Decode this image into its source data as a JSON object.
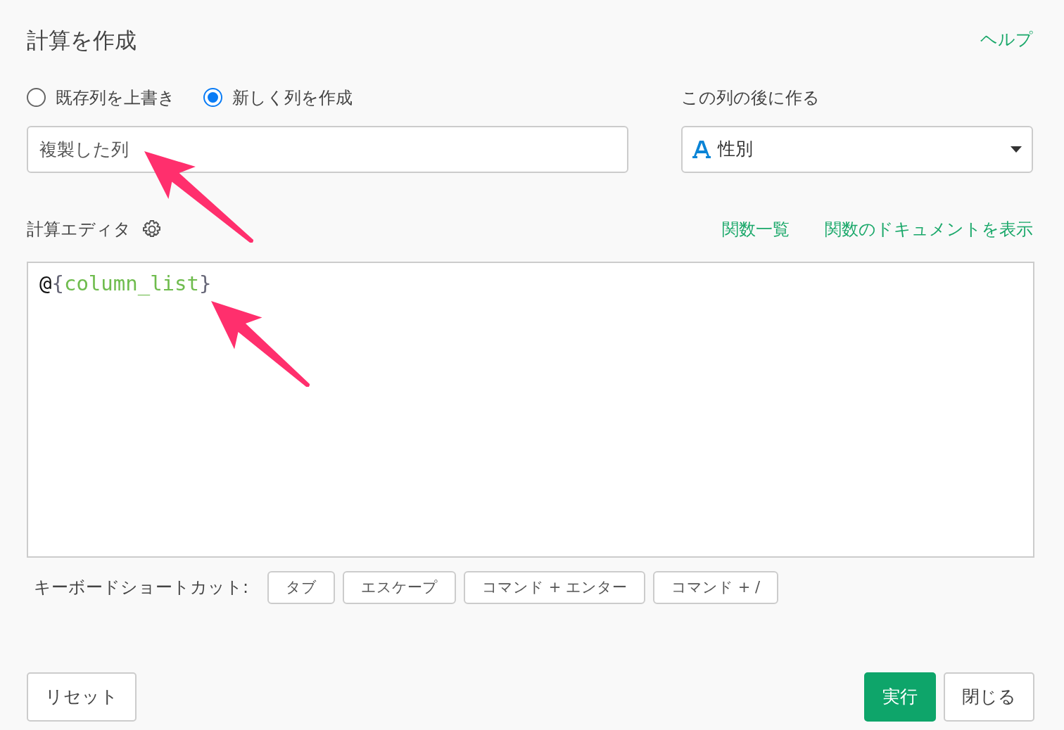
{
  "title": "計算を作成",
  "help_link": "ヘルプ",
  "modes": [
    {
      "label": "既存列を上書き",
      "selected": false
    },
    {
      "label": "新しく列を作成",
      "selected": true
    }
  ],
  "column_name": {
    "value": "複製した列"
  },
  "after_column": {
    "label": "この列の後に作る",
    "value": "性別"
  },
  "editor": {
    "label": "計算エディタ",
    "links": [
      "関数一覧",
      "関数のドキュメントを表示"
    ],
    "tokens": [
      {
        "kind": "plain",
        "text": "@"
      },
      {
        "kind": "bracket",
        "text": "{"
      },
      {
        "kind": "name",
        "text": "column_list"
      },
      {
        "kind": "bracket",
        "text": "}"
      }
    ]
  },
  "shortcuts": {
    "label": "キーボードショートカット:",
    "keys": [
      "タブ",
      "エスケープ",
      "コマンド + エンター",
      "コマンド + /"
    ]
  },
  "annotations": [
    {
      "kind": "arrow"
    },
    {
      "kind": "arrow"
    }
  ],
  "buttons": [
    {
      "label": "リセット",
      "kind": "secondary"
    },
    {
      "label": "実行",
      "kind": "primary"
    },
    {
      "label": "閉じる",
      "kind": "secondary"
    }
  ]
}
